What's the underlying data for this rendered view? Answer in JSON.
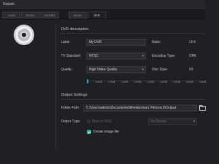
{
  "window": {
    "title": "Export"
  },
  "tabs": [
    {
      "label": "Local",
      "active": false
    },
    {
      "label": "Device",
      "active": false
    },
    {
      "label": "YouTube",
      "active": false
    },
    {
      "label": "Vimeo",
      "active": false
    },
    {
      "label": "DVD",
      "active": true
    }
  ],
  "dvd_description": {
    "heading": "DVD description",
    "label_label": "Label:",
    "label_value": "My DVD",
    "ratio_label": "Ratio:",
    "ratio_value": "16:9",
    "tv_standard_label": "TV Standard:",
    "tv_standard_value": "NTSC",
    "encoding_type_label": "Encoding Type:",
    "encoding_type_value": "CBR",
    "quality_label": "Quality:",
    "quality_value": "High Video Quality",
    "disc_type_label": "Disc Type:",
    "disc_type_value": "D5"
  },
  "size_meter": {
    "ticks": [
      "0.5GB",
      "1.0GB",
      "1.5GB",
      "2.0GB",
      "2.5GB",
      "3.0GB",
      "3.5GB",
      "4.0GB",
      "4.5GB"
    ],
    "fill_fraction": 0.01,
    "accent": "#2bb2a8"
  },
  "output_settings": {
    "heading": "Output Settings",
    "folder_path_label": "Folder Path:",
    "folder_path_value": "C:\\Users\\admin\\Documents\\Wondershare Filmora 9\\Output",
    "output_type_label": "Output Type:",
    "burn_to_dvd_label": "Burn to DVD",
    "no_device_label": "No Device",
    "create_image_label": "Create image file",
    "create_image_checked": true
  },
  "icons": {
    "disc": "dvd-disc-icon",
    "folder": "folder-icon",
    "dropdown": "chevron-down-icon"
  },
  "colors": {
    "background": "#1f2024",
    "accent": "#2bb2a8"
  }
}
